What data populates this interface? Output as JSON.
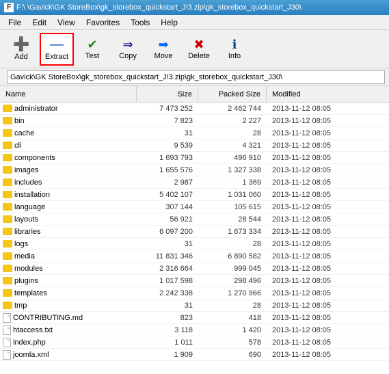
{
  "titlebar": {
    "icon": "F",
    "text": "F:\\ \\Gavick\\GK StoreBox\\gk_storebox_quickstart_J!3.zip\\gk_storebox_quickstart_J30\\"
  },
  "menubar": {
    "items": [
      "File",
      "Edit",
      "View",
      "Favorites",
      "Tools",
      "Help"
    ]
  },
  "toolbar": {
    "buttons": [
      {
        "id": "add",
        "label": "Add",
        "icon": "➕"
      },
      {
        "id": "extract",
        "label": "Extract",
        "icon": "➖",
        "active": true
      },
      {
        "id": "test",
        "label": "Test",
        "icon": "✔"
      },
      {
        "id": "copy",
        "label": "Copy",
        "icon": "➡"
      },
      {
        "id": "move",
        "label": "Move",
        "icon": "➜"
      },
      {
        "id": "delete",
        "label": "Delete",
        "icon": "✖"
      },
      {
        "id": "info",
        "label": "Info",
        "icon": "ℹ"
      }
    ]
  },
  "addressbar": {
    "label": "",
    "path": "Gavick\\GK StoreBox\\gk_storebox_quickstart_J!3.zip\\gk_storebox_quickstart_J30\\"
  },
  "columns": {
    "name": "Name",
    "size": "Size",
    "packed": "Packed Size",
    "modified": "Modified"
  },
  "files": [
    {
      "type": "folder",
      "name": "administrator",
      "size": "7 473 252",
      "packed": "2 462 744",
      "modified": "2013-11-12 08:05"
    },
    {
      "type": "folder",
      "name": "bin",
      "size": "7 823",
      "packed": "2 227",
      "modified": "2013-11-12 08:05"
    },
    {
      "type": "folder",
      "name": "cache",
      "size": "31",
      "packed": "28",
      "modified": "2013-11-12 08:05"
    },
    {
      "type": "folder",
      "name": "cli",
      "size": "9 539",
      "packed": "4 321",
      "modified": "2013-11-12 08:05"
    },
    {
      "type": "folder",
      "name": "components",
      "size": "1 693 793",
      "packed": "496 910",
      "modified": "2013-11-12 08:05"
    },
    {
      "type": "folder",
      "name": "images",
      "size": "1 655 576",
      "packed": "1 327 338",
      "modified": "2013-11-12 08:05"
    },
    {
      "type": "folder",
      "name": "includes",
      "size": "2 987",
      "packed": "1 369",
      "modified": "2013-11-12 08:05"
    },
    {
      "type": "folder",
      "name": "installation",
      "size": "5 402 107",
      "packed": "1 031 060",
      "modified": "2013-11-12 08:05"
    },
    {
      "type": "folder",
      "name": "language",
      "size": "307 144",
      "packed": "105 615",
      "modified": "2013-11-12 08:05"
    },
    {
      "type": "folder",
      "name": "layouts",
      "size": "56 921",
      "packed": "28 544",
      "modified": "2013-11-12 08:05"
    },
    {
      "type": "folder",
      "name": "libraries",
      "size": "6 097 200",
      "packed": "1 673 334",
      "modified": "2013-11-12 08:05"
    },
    {
      "type": "folder",
      "name": "logs",
      "size": "31",
      "packed": "28",
      "modified": "2013-11-12 08:05"
    },
    {
      "type": "folder",
      "name": "media",
      "size": "11 831 346",
      "packed": "6 890 582",
      "modified": "2013-11-12 08:05"
    },
    {
      "type": "folder",
      "name": "modules",
      "size": "2 316 664",
      "packed": "999 045",
      "modified": "2013-11-12 08:05"
    },
    {
      "type": "folder",
      "name": "plugins",
      "size": "1 017 598",
      "packed": "298 496",
      "modified": "2013-11-12 08:05"
    },
    {
      "type": "folder",
      "name": "templates",
      "size": "2 242 338",
      "packed": "1 270 966",
      "modified": "2013-11-12 08:05"
    },
    {
      "type": "folder",
      "name": "tmp",
      "size": "31",
      "packed": "28",
      "modified": "2013-11-12 08:05"
    },
    {
      "type": "file",
      "name": "CONTRIBUTING.md",
      "size": "823",
      "packed": "418",
      "modified": "2013-11-12 08:05"
    },
    {
      "type": "file",
      "name": "htaccess.txt",
      "size": "3 118",
      "packed": "1 420",
      "modified": "2013-11-12 08:05"
    },
    {
      "type": "file",
      "name": "index.php",
      "size": "1 011",
      "packed": "578",
      "modified": "2013-11-12 08:05"
    },
    {
      "type": "file",
      "name": "joomla.xml",
      "size": "1 909",
      "packed": "690",
      "modified": "2013-11-12 08:05"
    }
  ]
}
